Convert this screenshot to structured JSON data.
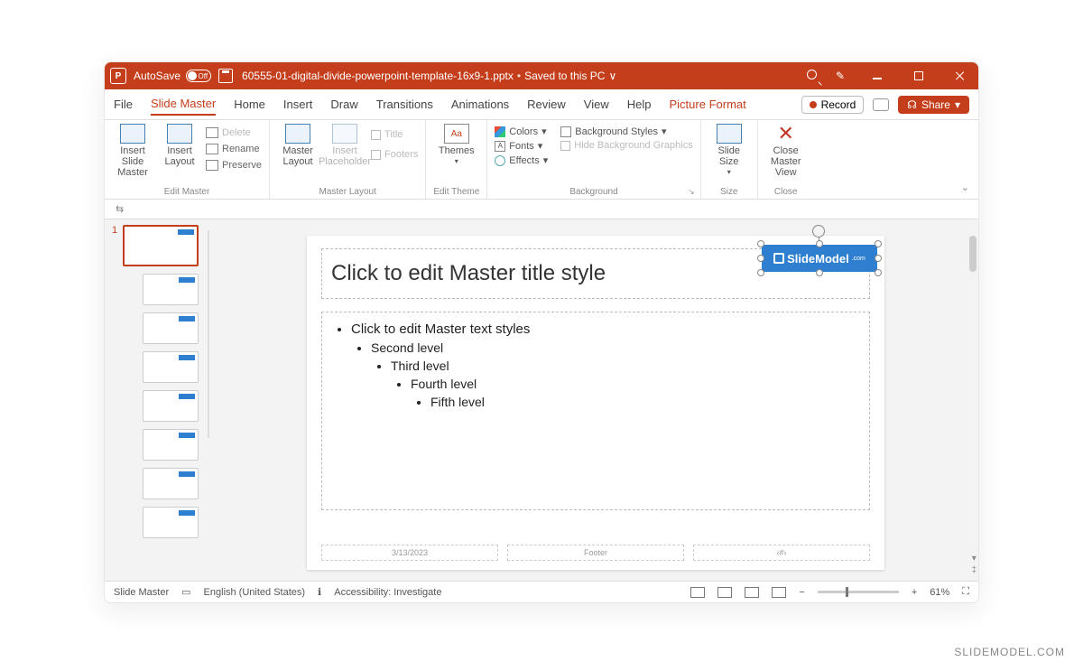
{
  "titlebar": {
    "autoSaveLabel": "AutoSave",
    "autoSaveState": "Off",
    "fileName": "60555-01-digital-divide-powerpoint-template-16x9-1.pptx",
    "saveStatus": "Saved to this PC"
  },
  "tabs": {
    "items": [
      "File",
      "Slide Master",
      "Home",
      "Insert",
      "Draw",
      "Transitions",
      "Animations",
      "Review",
      "View",
      "Help",
      "Picture Format"
    ],
    "activeIndex": 1,
    "contextIndex": 10,
    "record": "Record",
    "share": "Share"
  },
  "ribbon": {
    "editMaster": {
      "insertSlideMaster": "Insert Slide Master",
      "insertLayout": "Insert Layout",
      "delete": "Delete",
      "rename": "Rename",
      "preserve": "Preserve",
      "group": "Edit Master"
    },
    "masterLayout": {
      "masterLayout": "Master Layout",
      "insertPlaceholder": "Insert Placeholder",
      "title": "Title",
      "footers": "Footers",
      "group": "Master Layout"
    },
    "editTheme": {
      "themes": "Themes",
      "group": "Edit Theme"
    },
    "background": {
      "colors": "Colors",
      "fonts": "Fonts",
      "effects": "Effects",
      "bgStyles": "Background Styles",
      "hideBg": "Hide Background Graphics",
      "group": "Background"
    },
    "size": {
      "slideSize": "Slide Size",
      "group": "Size"
    },
    "close": {
      "closeMaster": "Close Master View",
      "group": "Close"
    }
  },
  "slide": {
    "number": "1",
    "titlePlaceholder": "Click to edit Master title style",
    "bodyLevels": [
      "Click to edit Master text styles",
      "Second level",
      "Third level",
      "Fourth level",
      "Fifth level"
    ],
    "logoText": "SlideModel",
    "date": "3/13/2023",
    "footer": "Footer",
    "slideNumPh": "‹#›"
  },
  "status": {
    "mode": "Slide Master",
    "language": "English (United States)",
    "accessibility": "Accessibility: Investigate",
    "zoom": "61%"
  },
  "watermark": "SLIDEMODEL.COM"
}
